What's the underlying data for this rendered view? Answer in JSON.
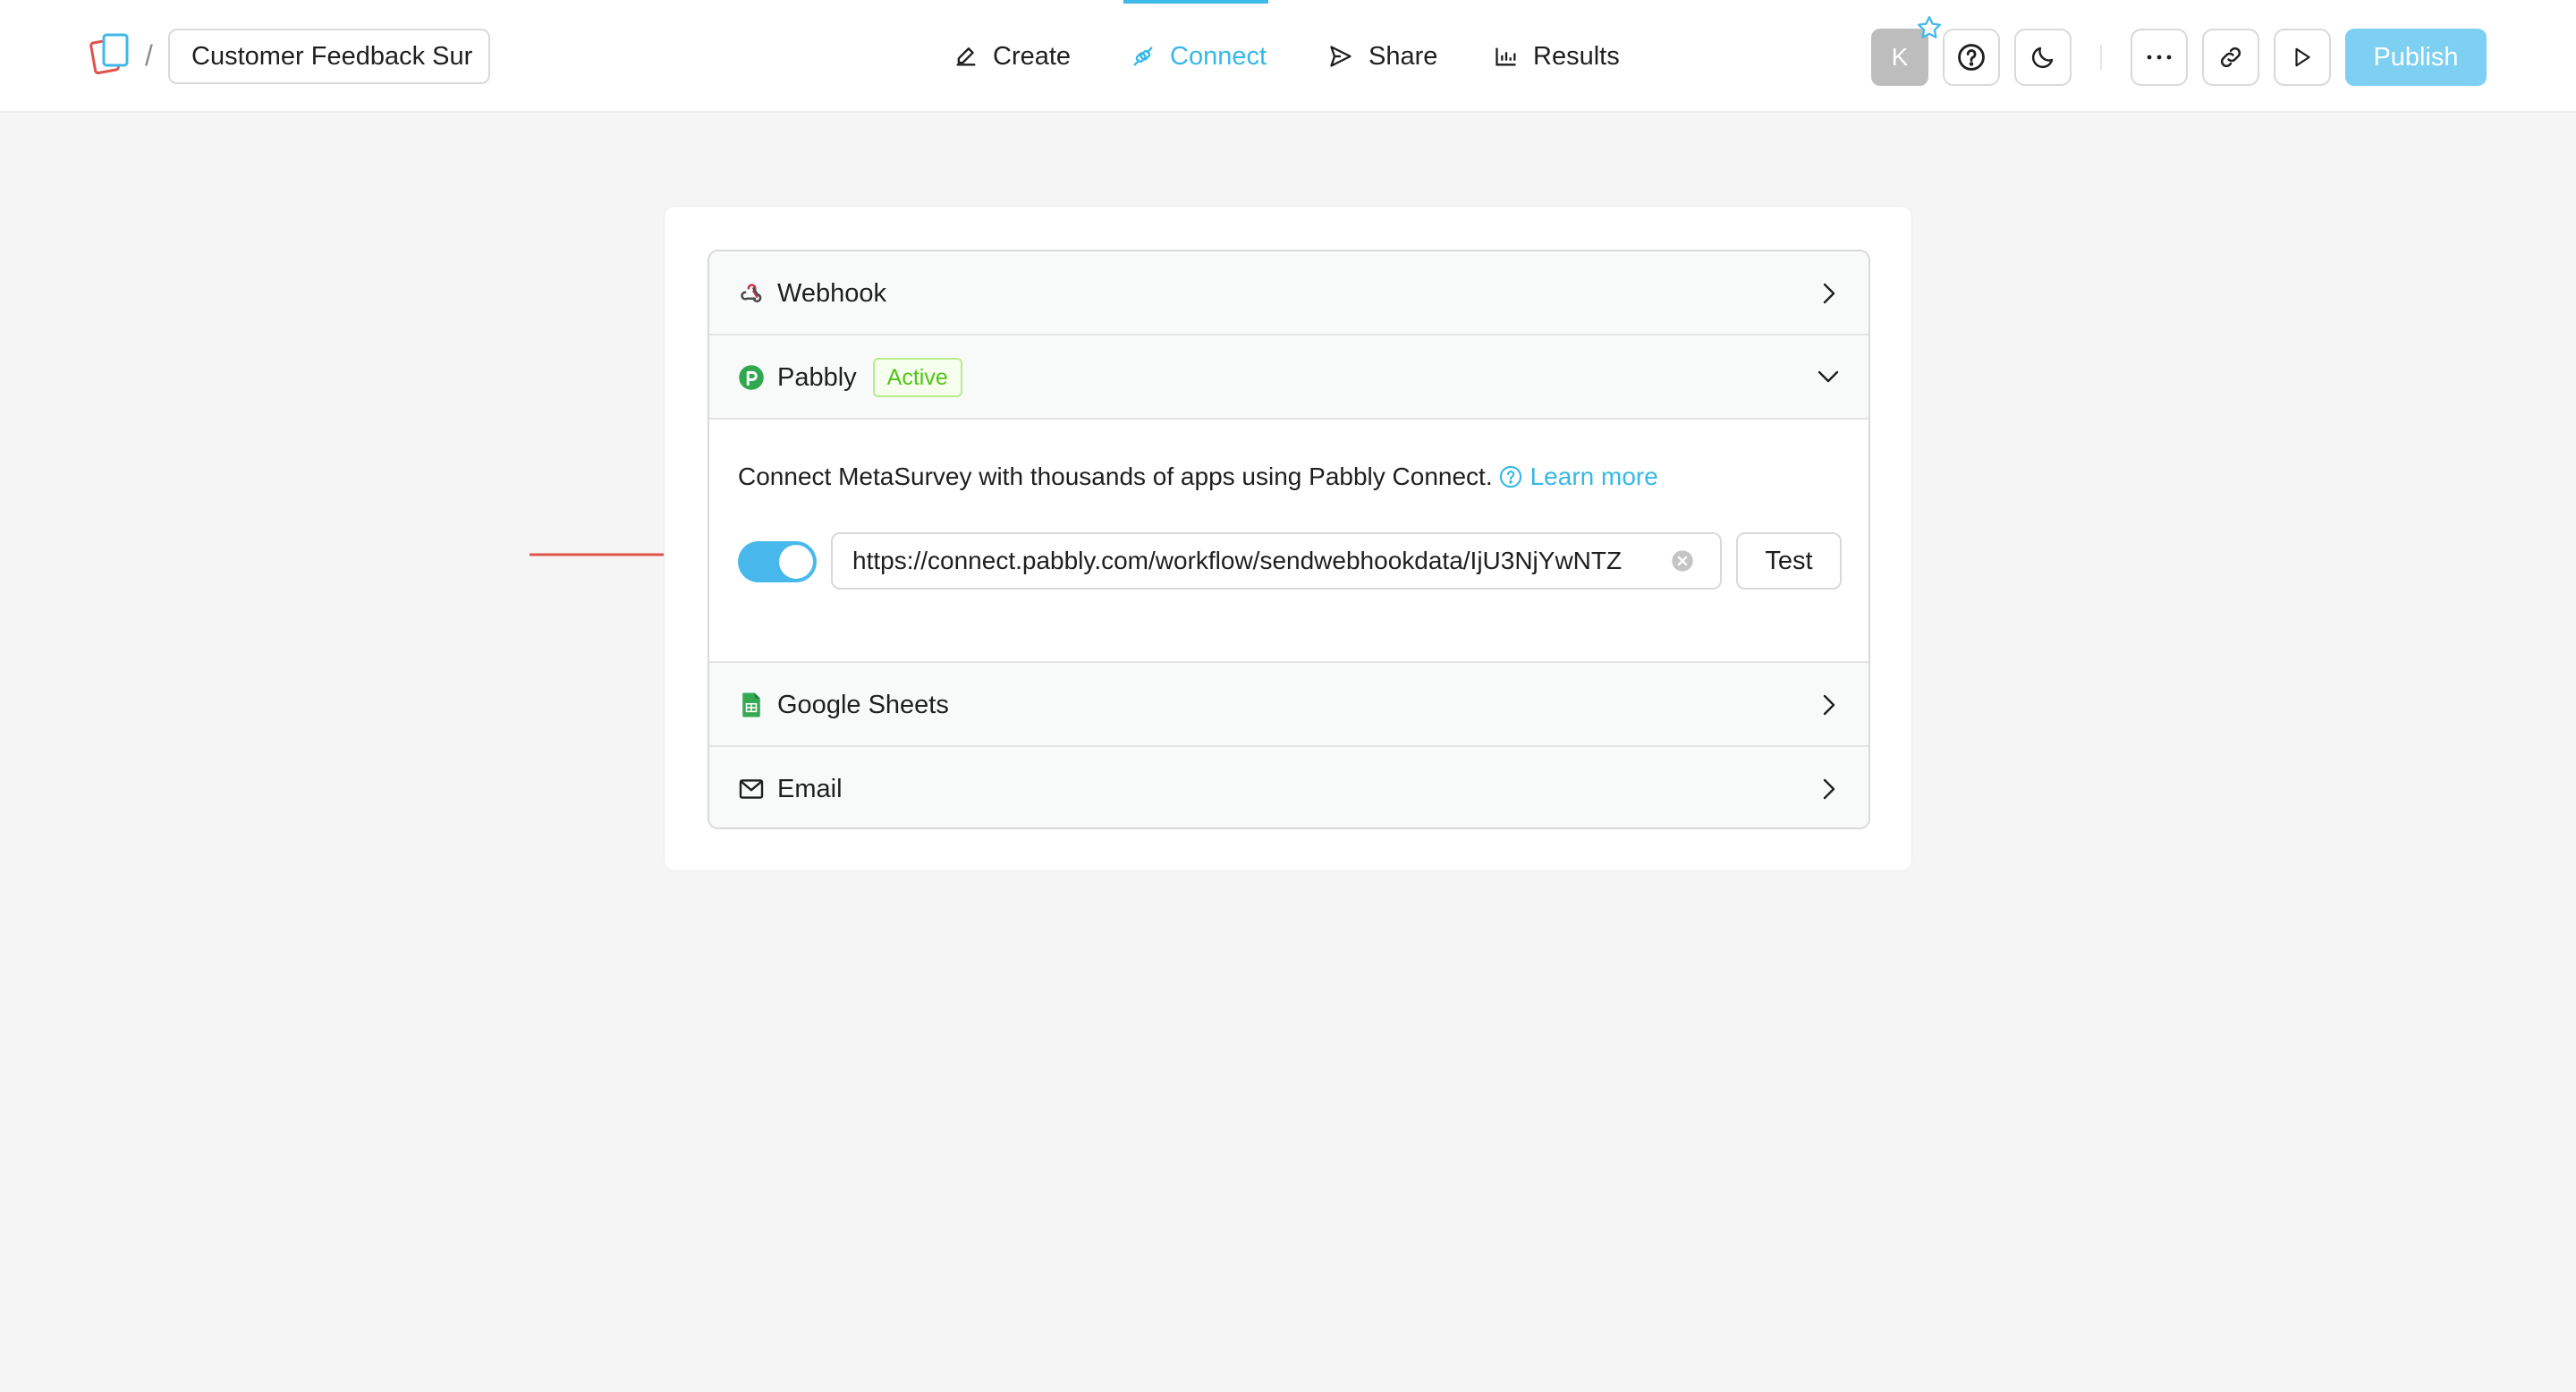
{
  "header": {
    "title": "Customer Feedback Sur",
    "breadcrumb_separator": "/",
    "nav": [
      {
        "label": "Create",
        "icon": "pencil-icon",
        "active": false
      },
      {
        "label": "Connect",
        "icon": "link-icon",
        "active": true
      },
      {
        "label": "Share",
        "icon": "send-icon",
        "active": false
      },
      {
        "label": "Results",
        "icon": "bar-chart-icon",
        "active": false
      }
    ],
    "avatar_initial": "K",
    "publish_label": "Publish"
  },
  "integrations": {
    "webhook": {
      "label": "Webhook",
      "icon": "webhook-icon"
    },
    "pabbly": {
      "label": "Pabbly",
      "icon": "pabbly-icon",
      "badge": "Active",
      "description": "Connect MetaSurvey with thousands of apps using Pabbly Connect.",
      "learn_more": "Learn more",
      "enabled": true,
      "url_value": "https://connect.pabbly.com/workflow/sendwebhookdata/IjU3NjYwNTZ",
      "test_label": "Test"
    },
    "google_sheets": {
      "label": "Google Sheets",
      "icon": "google-sheets-icon"
    },
    "email": {
      "label": "Email",
      "icon": "mail-icon"
    }
  },
  "colors": {
    "accent": "#36b8e7",
    "publish_bg": "#7dd0f2",
    "toggle_on": "#48b8ec",
    "badge_green": "#52c41a",
    "annotation_arrow": "#e0534a"
  }
}
